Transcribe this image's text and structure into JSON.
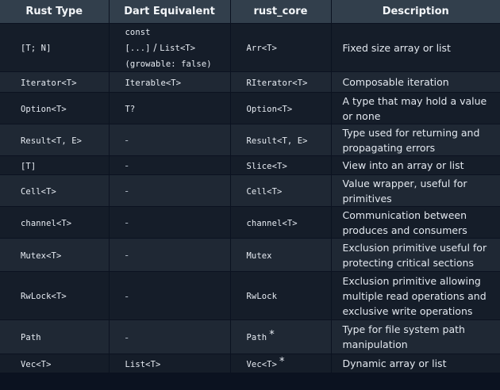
{
  "table": {
    "headers": [
      "Rust Type",
      "Dart Equivalent",
      "rust_core",
      "Description"
    ],
    "rows": [
      {
        "rust_type": "[T; N]",
        "dart_lines": [
          "const",
          "[...]",
          " / ",
          "List<T>",
          "(growable: false)"
        ],
        "rust_core": "Arr<T>",
        "description": "Fixed size array or list"
      },
      {
        "rust_type": "Iterator<T>",
        "dart": "Iterable<T>",
        "rust_core": "RIterator<T>",
        "description": "Composable iteration"
      },
      {
        "rust_type": "Option<T>",
        "dart": "T?",
        "rust_core": "Option<T>",
        "description": "A type that may hold a value or none"
      },
      {
        "rust_type": "Result<T, E>",
        "dart": "-",
        "rust_core": "Result<T, E>",
        "description": "Type used for returning and propagating errors"
      },
      {
        "rust_type": "[T]",
        "dart": "-",
        "rust_core": "Slice<T>",
        "description": "View into an array or list"
      },
      {
        "rust_type": "Cell<T>",
        "dart": "-",
        "rust_core": "Cell<T>",
        "description": "Value wrapper, useful for primitives"
      },
      {
        "rust_type": "channel<T>",
        "dart": "-",
        "rust_core": "channel<T>",
        "description": "Communication between produces and consumers"
      },
      {
        "rust_type": "Mutex<T>",
        "dart": "-",
        "rust_core": "Mutex",
        "description": "Exclusion primitive useful for protecting critical sections"
      },
      {
        "rust_type": "RwLock<T>",
        "dart": "-",
        "rust_core": "RwLock",
        "description": "Exclusion primitive allowing multiple read operations and exclusive write operations"
      },
      {
        "rust_type": "Path",
        "dart": "-",
        "rust_core": "Path",
        "rust_core_star": "*",
        "description": "Type for file system path manipulation"
      },
      {
        "rust_type": "Vec<T>",
        "dart": "List<T>",
        "rust_core": "Vec<T>",
        "rust_core_star": "*",
        "description": "Dynamic array or list"
      }
    ]
  }
}
